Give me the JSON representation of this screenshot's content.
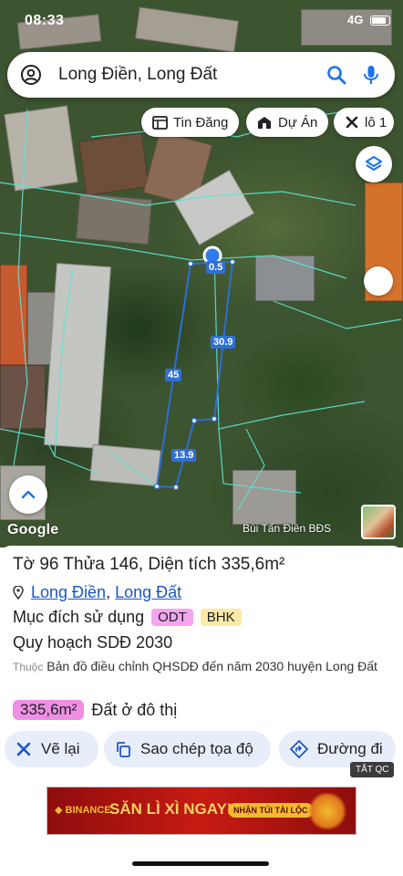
{
  "status_bar": {
    "time": "08:33",
    "network": "4G"
  },
  "search": {
    "query": "Long Điền, Long Đất"
  },
  "chips": [
    {
      "label": "Tin Đăng",
      "icon": "listing-icon"
    },
    {
      "label": "Dự Án",
      "icon": "building-icon"
    },
    {
      "label": "lô 1",
      "icon": "tools-icon"
    }
  ],
  "map": {
    "segment_labels": {
      "top": "0.5",
      "right": "30.9",
      "left": "45",
      "bottom": "13.9"
    },
    "google_logo": "Google",
    "watermark": "Bùi Tấn Điền BĐS",
    "parcel_color": "#2f6fd6"
  },
  "parcel": {
    "title": "Tờ 96 Thửa 146, Diện tích 335,6m²",
    "location_district": "Long Điền",
    "location_separator": ", ",
    "location_town": "Long Đất",
    "purpose_label": "Mục đích sử dụng",
    "purpose_badges": [
      {
        "code": "ODT",
        "color": "#f3a6ef"
      },
      {
        "code": "BHK",
        "color": "#fbeaa6"
      }
    ],
    "plan_label": "Quy hoạch SDĐ 2030",
    "belongs_prefix": "Thuộc",
    "belongs_text": "Bản đồ điều chỉnh QHSDĐ đến năm 2030 huyện Long Đất",
    "area_value": "335,6m²",
    "area_desc": "Đất ở đô thị"
  },
  "actions": [
    {
      "label": "Vẽ lại",
      "icon": "redraw-icon"
    },
    {
      "label": "Sao chép tọa độ",
      "icon": "copy-icon"
    },
    {
      "label": "Đường đi",
      "icon": "directions-icon"
    }
  ],
  "ad": {
    "tag": "TẮT QC",
    "brand": "◆ BINANCE",
    "headline": "SĂN LÌ XÌ NGAY!",
    "cta": "NHẬN TÚI TÀI LỘC"
  }
}
